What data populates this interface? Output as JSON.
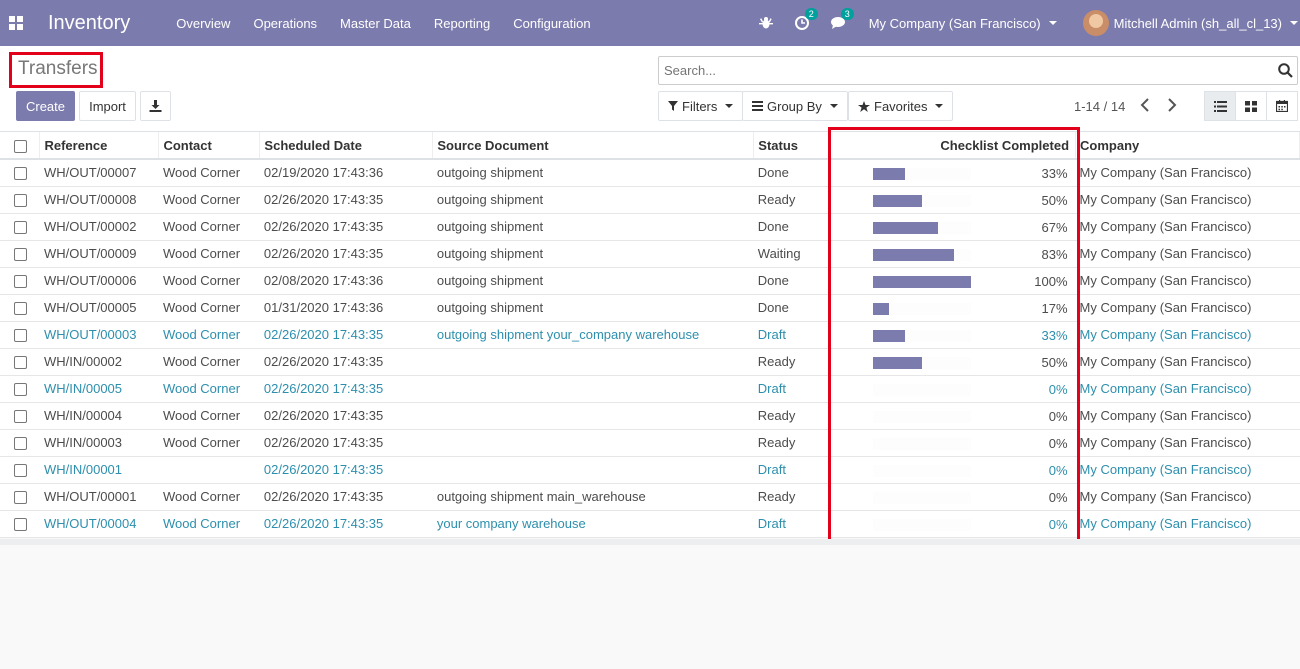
{
  "navbar": {
    "app_name": "Inventory",
    "menu": [
      "Overview",
      "Operations",
      "Master Data",
      "Reporting",
      "Configuration"
    ],
    "activity_count": "2",
    "message_count": "3",
    "company": "My Company (San Francisco)",
    "user": "Mitchell Admin (sh_all_cl_13)"
  },
  "control": {
    "title": "Transfers",
    "create_label": "Create",
    "import_label": "Import",
    "search_placeholder": "Search...",
    "filters_label": "Filters",
    "groupby_label": "Group By",
    "favorites_label": "Favorites",
    "pager": "1-14 / 14"
  },
  "table": {
    "headers": [
      "Reference",
      "Contact",
      "Scheduled Date",
      "Source Document",
      "Status",
      "Checklist Completed",
      "Company"
    ],
    "rows": [
      {
        "ref": "WH/OUT/00007",
        "contact": "Wood Corner",
        "date": "02/19/2020 17:43:36",
        "source": "outgoing shipment",
        "status": "Done",
        "pct": "33%",
        "frac": 0.33,
        "company": "My Company (San Francisco)",
        "draft": false
      },
      {
        "ref": "WH/OUT/00008",
        "contact": "Wood Corner",
        "date": "02/26/2020 17:43:35",
        "source": "outgoing shipment",
        "status": "Ready",
        "pct": "50%",
        "frac": 0.5,
        "company": "My Company (San Francisco)",
        "draft": false
      },
      {
        "ref": "WH/OUT/00002",
        "contact": "Wood Corner",
        "date": "02/26/2020 17:43:35",
        "source": "outgoing shipment",
        "status": "Done",
        "pct": "67%",
        "frac": 0.67,
        "company": "My Company (San Francisco)",
        "draft": false
      },
      {
        "ref": "WH/OUT/00009",
        "contact": "Wood Corner",
        "date": "02/26/2020 17:43:35",
        "source": "outgoing shipment",
        "status": "Waiting",
        "pct": "83%",
        "frac": 0.83,
        "company": "My Company (San Francisco)",
        "draft": false
      },
      {
        "ref": "WH/OUT/00006",
        "contact": "Wood Corner",
        "date": "02/08/2020 17:43:36",
        "source": "outgoing shipment",
        "status": "Done",
        "pct": "100%",
        "frac": 1.0,
        "company": "My Company (San Francisco)",
        "draft": false
      },
      {
        "ref": "WH/OUT/00005",
        "contact": "Wood Corner",
        "date": "01/31/2020 17:43:36",
        "source": "outgoing shipment",
        "status": "Done",
        "pct": "17%",
        "frac": 0.17,
        "company": "My Company (San Francisco)",
        "draft": false
      },
      {
        "ref": "WH/OUT/00003",
        "contact": "Wood Corner",
        "date": "02/26/2020 17:43:35",
        "source": "outgoing shipment your_company warehouse",
        "status": "Draft",
        "pct": "33%",
        "frac": 0.33,
        "company": "My Company (San Francisco)",
        "draft": true
      },
      {
        "ref": "WH/IN/00002",
        "contact": "Wood Corner",
        "date": "02/26/2020 17:43:35",
        "source": "",
        "status": "Ready",
        "pct": "50%",
        "frac": 0.5,
        "company": "My Company (San Francisco)",
        "draft": false
      },
      {
        "ref": "WH/IN/00005",
        "contact": "Wood Corner",
        "date": "02/26/2020 17:43:35",
        "source": "",
        "status": "Draft",
        "pct": "0%",
        "frac": 0,
        "company": "My Company (San Francisco)",
        "draft": true
      },
      {
        "ref": "WH/IN/00004",
        "contact": "Wood Corner",
        "date": "02/26/2020 17:43:35",
        "source": "",
        "status": "Ready",
        "pct": "0%",
        "frac": 0,
        "company": "My Company (San Francisco)",
        "draft": false
      },
      {
        "ref": "WH/IN/00003",
        "contact": "Wood Corner",
        "date": "02/26/2020 17:43:35",
        "source": "",
        "status": "Ready",
        "pct": "0%",
        "frac": 0,
        "company": "My Company (San Francisco)",
        "draft": false
      },
      {
        "ref": "WH/IN/00001",
        "contact": "",
        "date": "02/26/2020 17:43:35",
        "source": "",
        "status": "Draft",
        "pct": "0%",
        "frac": 0,
        "company": "My Company (San Francisco)",
        "draft": true
      },
      {
        "ref": "WH/OUT/00001",
        "contact": "Wood Corner",
        "date": "02/26/2020 17:43:35",
        "source": "outgoing shipment main_warehouse",
        "status": "Ready",
        "pct": "0%",
        "frac": 0,
        "company": "My Company (San Francisco)",
        "draft": false
      },
      {
        "ref": "WH/OUT/00004",
        "contact": "Wood Corner",
        "date": "02/26/2020 17:43:35",
        "source": "your company warehouse",
        "status": "Draft",
        "pct": "0%",
        "frac": 0,
        "company": "My Company (San Francisco)",
        "draft": true
      }
    ]
  },
  "colors": {
    "brand": "#7c7bad",
    "highlight": "#e3001b",
    "draft_text": "#2d8fad"
  }
}
